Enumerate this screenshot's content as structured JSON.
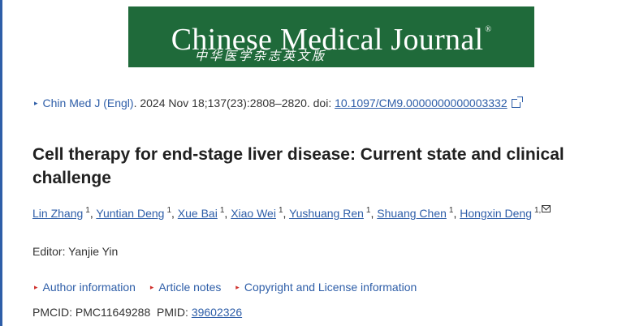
{
  "banner": {
    "title": "Chinese Medical Journal",
    "trademark": "®",
    "subtitle": "中华医学杂志英文版",
    "bg_color": "#1f6a3a"
  },
  "citation": {
    "journal": "Chin Med J (Engl)",
    "details": ". 2024 Nov 18;137(23):2808–2820. doi: ",
    "doi": "10.1097/CM9.0000000000003332"
  },
  "article": {
    "title": "Cell therapy for end-stage liver disease: Current state and clinical challenge"
  },
  "authors": [
    {
      "name": "Lin Zhang",
      "aff": "1"
    },
    {
      "name": "Yuntian Deng",
      "aff": "1"
    },
    {
      "name": "Xue Bai",
      "aff": "1"
    },
    {
      "name": "Xiao Wei",
      "aff": "1"
    },
    {
      "name": "Yushuang Ren",
      "aff": "1"
    },
    {
      "name": "Shuang Chen",
      "aff": "1"
    },
    {
      "name": "Hongxin Deng",
      "aff": "1,"
    }
  ],
  "editor": "Editor: Yanjie Yin",
  "info_links": {
    "author_info": "Author information",
    "article_notes": "Article notes",
    "copyright": "Copyright and License information"
  },
  "ids": {
    "pmcid_label": "PMCID: PMC11649288",
    "pmid_label": "PMID: ",
    "pmid": "39602326"
  },
  "colors": {
    "link": "#2e5ea8",
    "accent_red": "#d0312d"
  }
}
